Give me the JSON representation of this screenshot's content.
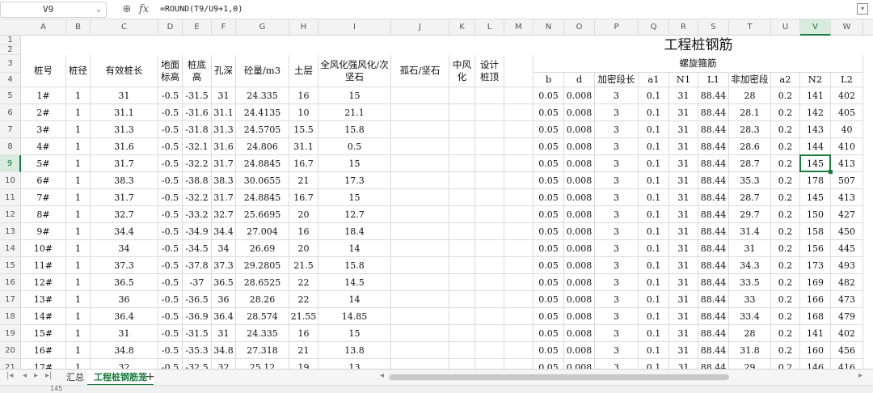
{
  "formula_bar": {
    "cell_ref": "V9",
    "formula": "=ROUND(T9/U9+1,0)",
    "fx_label": "fx"
  },
  "columns": [
    "A",
    "B",
    "C",
    "D",
    "E",
    "F",
    "G",
    "H",
    "I",
    "J",
    "K",
    "L",
    "M",
    "N",
    "O",
    "P",
    "Q",
    "R",
    "S",
    "T",
    "U",
    "V",
    "W"
  ],
  "selected_column": "V",
  "row_numbers": [
    "1",
    "2",
    "3",
    "4",
    "5",
    "6",
    "7",
    "8",
    "9",
    "10",
    "11",
    "12",
    "13",
    "14",
    "15",
    "16",
    "17",
    "18",
    "19",
    "20",
    "21"
  ],
  "selected_row": "9",
  "sheet": {
    "title": "工程桩钢筋",
    "spiral_header": "螺旋箍筋",
    "headers_left": {
      "pile_no": "桩号",
      "pile_dia": "桩径",
      "eff_len": "有效桩长",
      "ground_elev": "地面标高",
      "pile_bottom": "桩底高",
      "hole_depth": "孔深",
      "concrete": "砼量/m3",
      "soil": "土层",
      "weathered": "全风化强风化/次坚石",
      "boulder": "孤石/坚石",
      "mid_weathered": "中风化",
      "design_top": "设计桩顶"
    },
    "headers_spiral": [
      "b",
      "d",
      "加密段长",
      "a1",
      "N1",
      "L1",
      "非加密段",
      "a2",
      "N2",
      "L2"
    ],
    "rows": [
      [
        "1#",
        "1",
        "31",
        "-0.5",
        "-31.5",
        "31",
        "24.335",
        "16",
        "15",
        "",
        "",
        "",
        "",
        "0.05",
        "0.008",
        "3",
        "0.1",
        "31",
        "88.44",
        "28",
        "0.2",
        "141",
        "402"
      ],
      [
        "2#",
        "1",
        "31.1",
        "-0.5",
        "-31.6",
        "31.1",
        "24.4135",
        "10",
        "21.1",
        "",
        "",
        "",
        "",
        "0.05",
        "0.008",
        "3",
        "0.1",
        "31",
        "88.44",
        "28.1",
        "0.2",
        "142",
        "405"
      ],
      [
        "3#",
        "1",
        "31.3",
        "-0.5",
        "-31.8",
        "31.3",
        "24.5705",
        "15.5",
        "15.8",
        "",
        "",
        "",
        "",
        "0.05",
        "0.008",
        "3",
        "0.1",
        "31",
        "88.44",
        "28.3",
        "0.2",
        "143",
        "40"
      ],
      [
        "4#",
        "1",
        "31.6",
        "-0.5",
        "-32.1",
        "31.6",
        "24.806",
        "31.1",
        "0.5",
        "",
        "",
        "",
        "",
        "0.05",
        "0.008",
        "3",
        "0.1",
        "31",
        "88.44",
        "28.6",
        "0.2",
        "144",
        "410"
      ],
      [
        "5#",
        "1",
        "31.7",
        "-0.5",
        "-32.2",
        "31.7",
        "24.8845",
        "16.7",
        "15",
        "",
        "",
        "",
        "",
        "0.05",
        "0.008",
        "3",
        "0.1",
        "31",
        "88.44",
        "28.7",
        "0.2",
        "145",
        "413"
      ],
      [
        "6#",
        "1",
        "38.3",
        "-0.5",
        "-38.8",
        "38.3",
        "30.0655",
        "21",
        "17.3",
        "",
        "",
        "",
        "",
        "0.05",
        "0.008",
        "3",
        "0.1",
        "31",
        "88.44",
        "35.3",
        "0.2",
        "178",
        "507"
      ],
      [
        "7#",
        "1",
        "31.7",
        "-0.5",
        "-32.2",
        "31.7",
        "24.8845",
        "16.7",
        "15",
        "",
        "",
        "",
        "",
        "0.05",
        "0.008",
        "3",
        "0.1",
        "31",
        "88.44",
        "28.7",
        "0.2",
        "145",
        "413"
      ],
      [
        "8#",
        "1",
        "32.7",
        "-0.5",
        "-33.2",
        "32.7",
        "25.6695",
        "20",
        "12.7",
        "",
        "",
        "",
        "",
        "0.05",
        "0.008",
        "3",
        "0.1",
        "31",
        "88.44",
        "29.7",
        "0.2",
        "150",
        "427"
      ],
      [
        "9#",
        "1",
        "34.4",
        "-0.5",
        "-34.9",
        "34.4",
        "27.004",
        "16",
        "18.4",
        "",
        "",
        "",
        "",
        "0.05",
        "0.008",
        "3",
        "0.1",
        "31",
        "88.44",
        "31.4",
        "0.2",
        "158",
        "450"
      ],
      [
        "10#",
        "1",
        "34",
        "-0.5",
        "-34.5",
        "34",
        "26.69",
        "20",
        "14",
        "",
        "",
        "",
        "",
        "0.05",
        "0.008",
        "3",
        "0.1",
        "31",
        "88.44",
        "31",
        "0.2",
        "156",
        "445"
      ],
      [
        "11#",
        "1",
        "37.3",
        "-0.5",
        "-37.8",
        "37.3",
        "29.2805",
        "21.5",
        "15.8",
        "",
        "",
        "",
        "",
        "0.05",
        "0.008",
        "3",
        "0.1",
        "31",
        "88.44",
        "34.3",
        "0.2",
        "173",
        "493"
      ],
      [
        "12#",
        "1",
        "36.5",
        "-0.5",
        "-37",
        "36.5",
        "28.6525",
        "22",
        "14.5",
        "",
        "",
        "",
        "",
        "0.05",
        "0.008",
        "3",
        "0.1",
        "31",
        "88.44",
        "33.5",
        "0.2",
        "169",
        "482"
      ],
      [
        "13#",
        "1",
        "36",
        "-0.5",
        "-36.5",
        "36",
        "28.26",
        "22",
        "14",
        "",
        "",
        "",
        "",
        "0.05",
        "0.008",
        "3",
        "0.1",
        "31",
        "88.44",
        "33",
        "0.2",
        "166",
        "473"
      ],
      [
        "14#",
        "1",
        "36.4",
        "-0.5",
        "-36.9",
        "36.4",
        "28.574",
        "21.55",
        "14.85",
        "",
        "",
        "",
        "",
        "0.05",
        "0.008",
        "3",
        "0.1",
        "31",
        "88.44",
        "33.4",
        "0.2",
        "168",
        "479"
      ],
      [
        "15#",
        "1",
        "31",
        "-0.5",
        "-31.5",
        "31",
        "24.335",
        "16",
        "15",
        "",
        "",
        "",
        "",
        "0.05",
        "0.008",
        "3",
        "0.1",
        "31",
        "88.44",
        "28",
        "0.2",
        "141",
        "402"
      ],
      [
        "16#",
        "1",
        "34.8",
        "-0.5",
        "-35.3",
        "34.8",
        "27.318",
        "21",
        "13.8",
        "",
        "",
        "",
        "",
        "0.05",
        "0.008",
        "3",
        "0.1",
        "31",
        "88.44",
        "31.8",
        "0.2",
        "160",
        "456"
      ],
      [
        "17#",
        "1",
        "32",
        "-0.5",
        "-32.5",
        "32",
        "25.12",
        "19",
        "13",
        "",
        "",
        "",
        "",
        "0.05",
        "0.008",
        "3",
        "0.1",
        "31",
        "88.44",
        "29",
        "0.2",
        "146",
        "416"
      ]
    ]
  },
  "tabs": {
    "summary": "汇总",
    "active": "工程桩钢筋笼",
    "add": "+"
  },
  "status": {
    "value": "145"
  },
  "colors": {
    "accent": "#1a7a3f",
    "grid": "#dadada",
    "header_bg": "#f3f3f3"
  }
}
